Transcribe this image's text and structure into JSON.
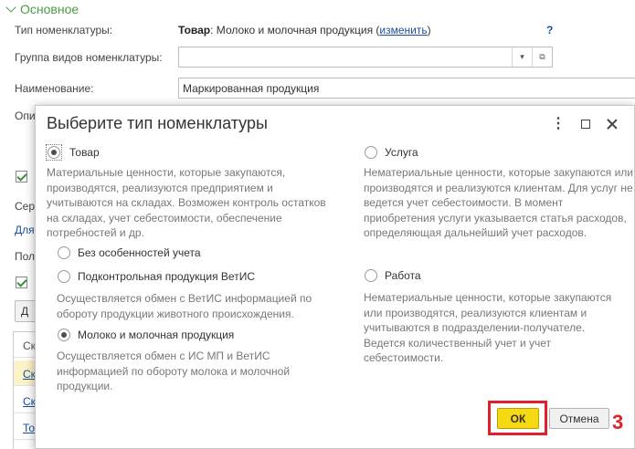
{
  "form": {
    "section_title": "Основное",
    "type_label": "Тип номенклатуры:",
    "type_value_bold": "Товар",
    "type_value_rest": ": Молоко и молочная продукция (",
    "type_change_link": "изменить",
    "type_value_end": ")",
    "help": "?",
    "group_label": "Группа видов номенклатуры:",
    "group_value": "",
    "name_label": "Наименование:",
    "name_value": "Маркированная продукция",
    "frag_opi": "Опи",
    "frag_ser": "Сер",
    "frag_dlya": "Для",
    "frag_pol": "Пол",
    "frag_btn": "Д",
    "frag_row0": "Ск",
    "frag_row1": "Ск",
    "frag_row2": "Ск",
    "frag_row3": "То"
  },
  "dialog": {
    "title": "Выберите тип номенклатуры",
    "options": {
      "tovar": {
        "label": "Товар",
        "selected": true,
        "description": "Материальные ценности, которые закупаются, производятся, реализуются предприятием и учитываются на складах. Возможен контроль остатков на складах, учет себестоимости, обеспечение потребностей и др."
      },
      "usluga": {
        "label": "Услуга",
        "selected": false,
        "description": "Нематериальные ценности, которые закупаются или производятся и реализуются клиентам. Для услуг не ведется учет себестоимости. В момент приобретения услуги указывается статья расходов, определяющая дальнейший учет расходов."
      },
      "rabota": {
        "label": "Работа",
        "selected": false,
        "description": "Нематериальные ценности, которые закупаются или производятся, реализуются клиентам и учитываются в подразделении-получателе. Ведется количественный учет и учет себестоимости."
      }
    },
    "sub_options": {
      "no_features": {
        "label": "Без особенностей учета",
        "selected": false
      },
      "vetis": {
        "label": "Подконтрольная продукция ВетИС",
        "selected": false,
        "description": "Осуществляется обмен с ВетИС информацией по обороту продукции животного происхождения."
      },
      "milk": {
        "label": "Молоко и молочная продукция",
        "selected": true,
        "description": "Осуществляется обмен с ИС МП и ВетИС информацией по обороту молока и молочной продукции."
      }
    },
    "ok_label": "ОК",
    "cancel_label": "Отмена"
  },
  "annotation": {
    "step_number": "3",
    "color": "#e0202a"
  },
  "colors": {
    "accent_green": "#4b9b47",
    "ok_yellow": "#f5d913",
    "link_blue": "#1a4f9c"
  }
}
